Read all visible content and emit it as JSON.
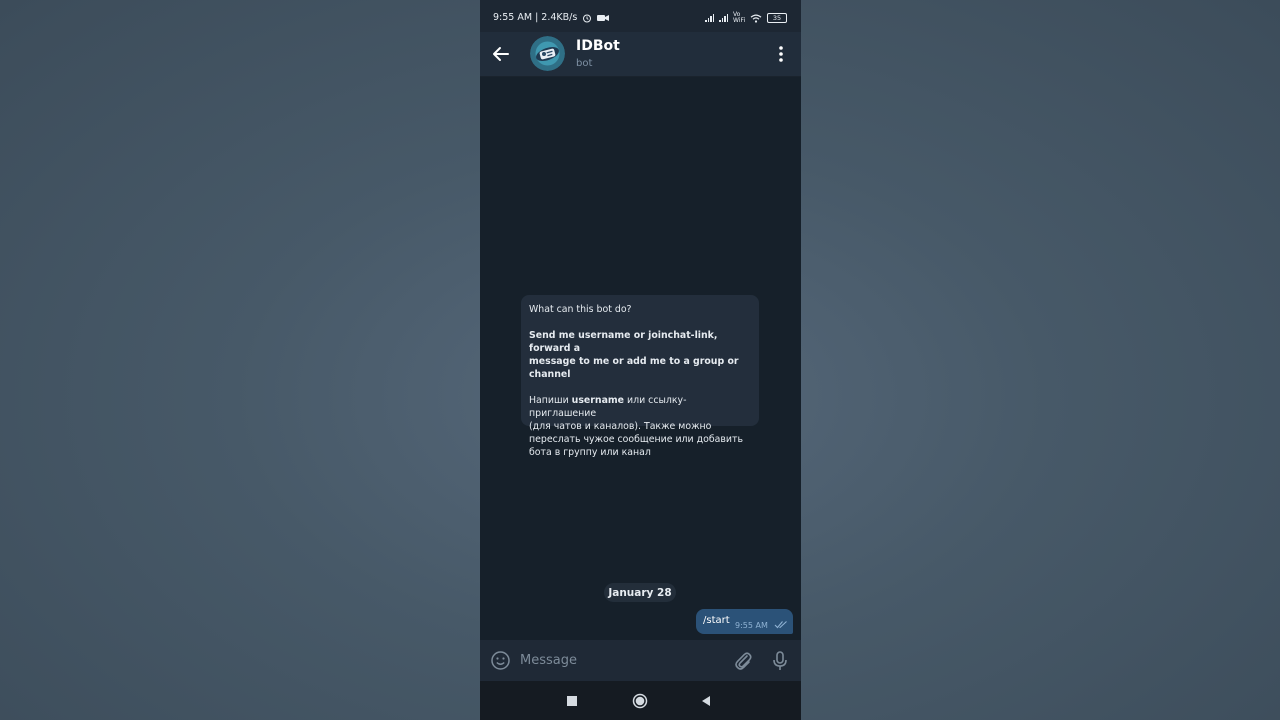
{
  "status_bar": {
    "time_info": "9:55 AM | 2.4KB/s",
    "network": "Vo WiFi",
    "battery": "35"
  },
  "header": {
    "title": "IDBot",
    "subtitle": "bot"
  },
  "bot_info": {
    "heading": "What can this bot do?",
    "english_line1": "Send me username or joinchat-link, forward a",
    "english_line2": "message to me or add me to a group or channel",
    "russian_line1_prefix": "Напиши ",
    "russian_line1_bold": "username",
    "russian_line1_suffix": " или ссылку-приглашение",
    "russian_line2": "(для чатов и каналов). Также можно",
    "russian_line3": "переслать чужое сообщение или добавить",
    "russian_line4": "бота в группу или канал"
  },
  "date_divider": "January 28",
  "messages": [
    {
      "text": "/start",
      "time": "9:55 AM",
      "status": "read"
    }
  ],
  "composer": {
    "placeholder": "Message"
  },
  "colors": {
    "accent": "#2b5278",
    "header_bg": "#212d3b",
    "chat_bg": "#16202a"
  }
}
